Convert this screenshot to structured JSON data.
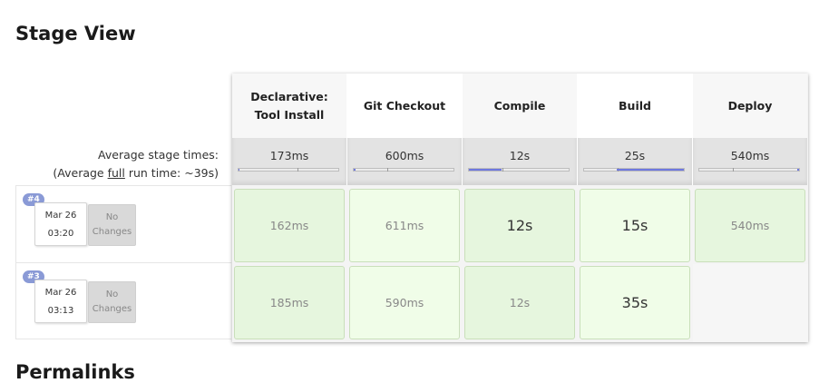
{
  "page": {
    "title": "Stage View",
    "next_section_title": "Permalinks"
  },
  "summary": {
    "avg_stage_times_label": "Average stage times:",
    "avg_full_prefix": "(Average ",
    "avg_full_link": "full",
    "avg_full_suffix": " run time: ~39s)"
  },
  "stages": [
    {
      "name_line1": "Declarative:",
      "name_line2": "Tool Install",
      "avg": "173ms",
      "avg_fraction": 0.0
    },
    {
      "name_line1": "Git Checkout",
      "name_line2": "",
      "avg": "600ms",
      "avg_fraction": 0.02
    },
    {
      "name_line1": "Compile",
      "name_line2": "",
      "avg": "12s",
      "avg_fraction": 0.33
    },
    {
      "name_line1": "Build",
      "name_line2": "",
      "avg": "25s",
      "avg_fraction": 0.67
    },
    {
      "name_line1": "Deploy",
      "name_line2": "",
      "avg": "540ms",
      "avg_fraction": 0.01
    }
  ],
  "builds": [
    {
      "badge": "#4",
      "date": "Mar 26",
      "time": "03:20",
      "changes": [
        "No",
        "Changes"
      ],
      "durations": [
        "162ms",
        "611ms",
        "12s",
        "15s",
        "540ms"
      ]
    },
    {
      "badge": "#3",
      "date": "Mar 26",
      "time": "03:13",
      "changes": [
        "No",
        "Changes"
      ],
      "durations": [
        "185ms",
        "590ms",
        "12s",
        "35s",
        ""
      ]
    }
  ],
  "colors": {
    "success_cell": "#e6f6de",
    "success_cell_light": "#f0fde8",
    "progress_fill": "#6e78df",
    "badge": "#8a9ad6"
  }
}
